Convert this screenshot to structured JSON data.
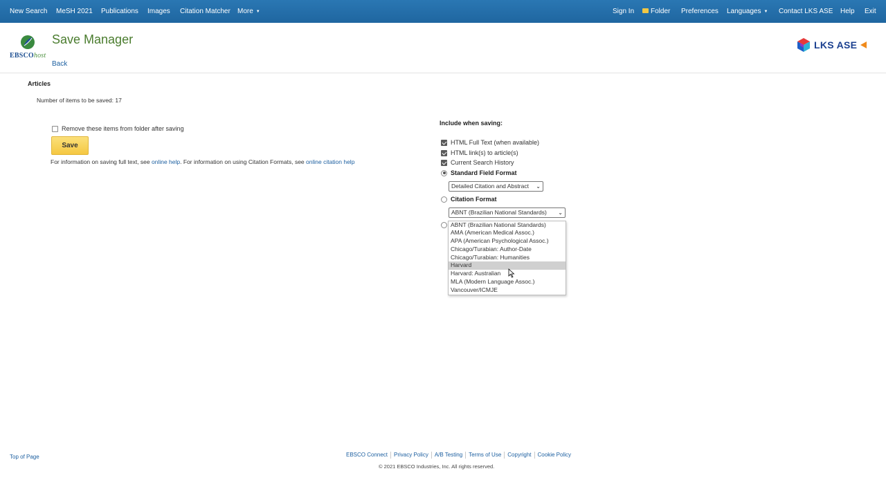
{
  "nav": {
    "left": [
      "New Search",
      "MeSH 2021",
      "Publications",
      "Images",
      "Citation Matcher",
      "More"
    ],
    "right": {
      "sign_in": "Sign In",
      "folder": "Folder",
      "preferences": "Preferences",
      "languages": "Languages",
      "contact": "Contact LKS ASE",
      "help": "Help",
      "exit": "Exit"
    }
  },
  "header": {
    "logo_brand": "EBSCO",
    "logo_host": "host",
    "title": "Save Manager",
    "back": "Back",
    "partner_logo": "LKS ASE"
  },
  "main": {
    "section_heading": "Articles",
    "items_count": "Number of items to be saved: 17",
    "remove_label": "Remove these items from folder after saving",
    "remove_checked": false,
    "save_label": "Save",
    "info": {
      "part1": "For information on saving full text, see ",
      "link1": "online help",
      "part2": ". For information on using Citation Formats, see ",
      "link2": "online citation help"
    }
  },
  "include": {
    "heading": "Include when saving:",
    "checkboxes": [
      {
        "label": "HTML Full Text (when available)",
        "checked": true
      },
      {
        "label": "HTML link(s) to article(s)",
        "checked": true
      },
      {
        "label": "Current Search History",
        "checked": true
      }
    ],
    "standard_format": {
      "label": "Standard Field Format",
      "selected": true,
      "value": "Detailed Citation and Abstract"
    },
    "citation_format": {
      "label": "Citation Format",
      "selected": false,
      "value": "ABNT (Brazilian National Standards)"
    },
    "citation_options": [
      "ABNT (Brazilian National Standards)",
      "AMA (American Medical Assoc.)",
      "APA (American Psychological Assoc.)",
      "Chicago/Turabian: Author-Date",
      "Chicago/Turabian: Humanities",
      "Harvard",
      "Harvard: Australian",
      "MLA (Modern Language Assoc.)",
      "Vancouver/ICMJE"
    ],
    "highlighted_option": "Harvard"
  },
  "footer": {
    "top_of_page": "Top of Page",
    "links": [
      "EBSCO Connect",
      "Privacy Policy",
      "A/B Testing",
      "Terms of Use",
      "Copyright",
      "Cookie Policy"
    ],
    "copyright": "© 2021 EBSCO Industries, Inc. All rights reserved."
  },
  "colors": {
    "nav_bar": "#1f66a0",
    "title_green": "#4a7c2e",
    "link_blue": "#1c5fa0",
    "save_button": "#f5c842"
  }
}
